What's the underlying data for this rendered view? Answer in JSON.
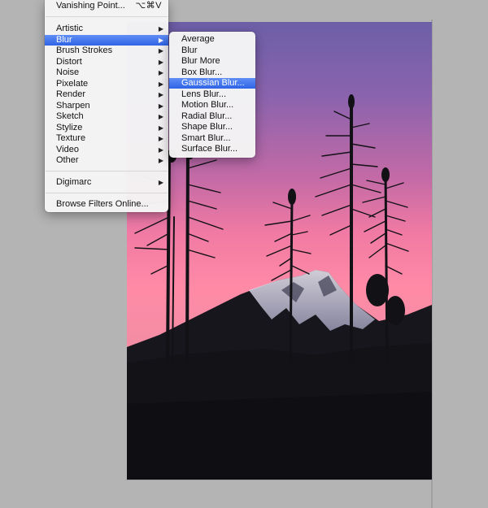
{
  "filter_menu": {
    "vanishing_point": {
      "label": "Vanishing Point...",
      "shortcut": "⌥⌘V"
    },
    "groups": [
      [
        {
          "label": "Artistic",
          "submenu": true
        },
        {
          "label": "Blur",
          "submenu": true,
          "selected": true
        },
        {
          "label": "Brush Strokes",
          "submenu": true
        },
        {
          "label": "Distort",
          "submenu": true
        },
        {
          "label": "Noise",
          "submenu": true
        },
        {
          "label": "Pixelate",
          "submenu": true
        },
        {
          "label": "Render",
          "submenu": true
        },
        {
          "label": "Sharpen",
          "submenu": true
        },
        {
          "label": "Sketch",
          "submenu": true
        },
        {
          "label": "Stylize",
          "submenu": true
        },
        {
          "label": "Texture",
          "submenu": true
        },
        {
          "label": "Video",
          "submenu": true
        },
        {
          "label": "Other",
          "submenu": true
        }
      ],
      [
        {
          "label": "Digimarc",
          "submenu": true
        }
      ],
      [
        {
          "label": "Browse Filters Online...",
          "submenu": false
        }
      ]
    ]
  },
  "blur_submenu": {
    "items": [
      {
        "label": "Average"
      },
      {
        "label": "Blur"
      },
      {
        "label": "Blur More"
      },
      {
        "label": "Box Blur..."
      },
      {
        "label": "Gaussian Blur...",
        "selected": true
      },
      {
        "label": "Lens Blur..."
      },
      {
        "label": "Motion Blur..."
      },
      {
        "label": "Radial Blur..."
      },
      {
        "label": "Shape Blur..."
      },
      {
        "label": "Smart Blur..."
      },
      {
        "label": "Surface Blur..."
      }
    ]
  },
  "colors": {
    "menu_highlight": "#3d6ff0",
    "workspace": "#b4b4b4",
    "sky_top": "#6f5fa6",
    "sky_glow": "#f77fa3",
    "silhouette": "#141317"
  }
}
